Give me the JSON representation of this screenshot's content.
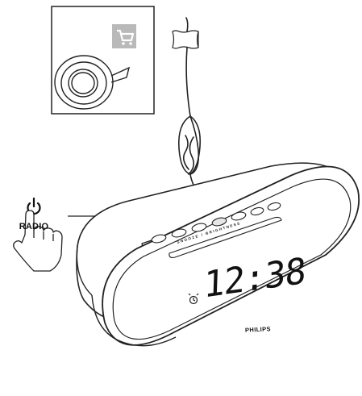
{
  "labels": {
    "mode": "RADIO",
    "time": "12:38",
    "brand": "PHILIPS",
    "buttons_strip": "SNOOZE / BRIGHTNESS"
  },
  "icons": {
    "power": "power-icon",
    "hand": "hand-pointer-icon",
    "cart": "cart-icon",
    "tape": "tape-roll-icon",
    "alarm": "alarm-bell-icon"
  },
  "colors": {
    "line": "#1a1a1a",
    "cart_badge": "#b9b9b9",
    "background": "#ffffff"
  }
}
